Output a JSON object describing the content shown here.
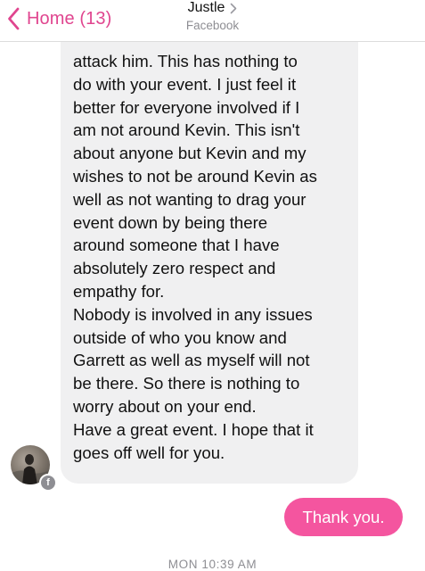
{
  "nav": {
    "back_label": "Home (13)",
    "contact_name": "Justle",
    "subtitle": "Facebook",
    "accent_color": "#e0458f"
  },
  "thread": {
    "incoming_lines": [
      "attack him. This has nothing to",
      "do with your event. I just feel it",
      "better for everyone involved if I",
      "am not around Kevin. This isn't",
      "about anyone but Kevin and my",
      "wishes to not be around Kevin as",
      "well as not wanting to drag your",
      "event down by being there",
      "around someone that I have",
      "absolutely zero respect and",
      "empathy for.",
      "Nobody is involved in any issues",
      "outside of who you know and",
      "Garrett as well as myself will not",
      "be there. So there is nothing to",
      "worry about on your end.",
      "Have a great event. I hope that it",
      "goes off well for you."
    ],
    "outgoing_text": "Thank you.",
    "outgoing_color": "#f4559f",
    "timestamp": "MON 10:39 AM",
    "avatar_badge": "f"
  }
}
